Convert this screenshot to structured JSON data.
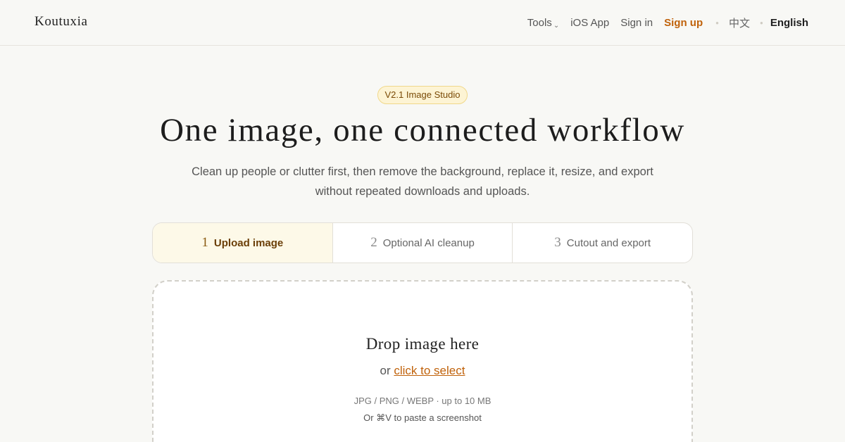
{
  "header": {
    "brand": "Koutuxia",
    "nav": {
      "tools": "Tools",
      "ios_app": "iOS App",
      "sign_in": "Sign in",
      "sign_up": "Sign up",
      "lang_zh": "中文",
      "lang_en": "English"
    }
  },
  "hero": {
    "badge": "V2.1 Image Studio",
    "title": "One image, one connected workflow",
    "subtitle": "Clean up people or clutter first, then remove the background, replace it, resize, and export without repeated downloads and uploads."
  },
  "steps": [
    {
      "num": "1",
      "label": "Upload image",
      "active": true
    },
    {
      "num": "2",
      "label": "Optional AI cleanup",
      "active": false
    },
    {
      "num": "3",
      "label": "Cutout and export",
      "active": false
    }
  ],
  "dropzone": {
    "title": "Drop image here",
    "or_text": "or",
    "link_text": "click to select",
    "formats": "JPG / PNG / WEBP · up to 10 MB",
    "paste_hint": "Or ⌘V to paste a screenshot"
  },
  "colors": {
    "accent": "#c0620b",
    "background": "#f8f8f5",
    "badge_bg": "#fdf4d4",
    "active_step_bg": "#fdf9e8"
  },
  "icons": {
    "tools_dropdown": "chevron-down-icon"
  }
}
